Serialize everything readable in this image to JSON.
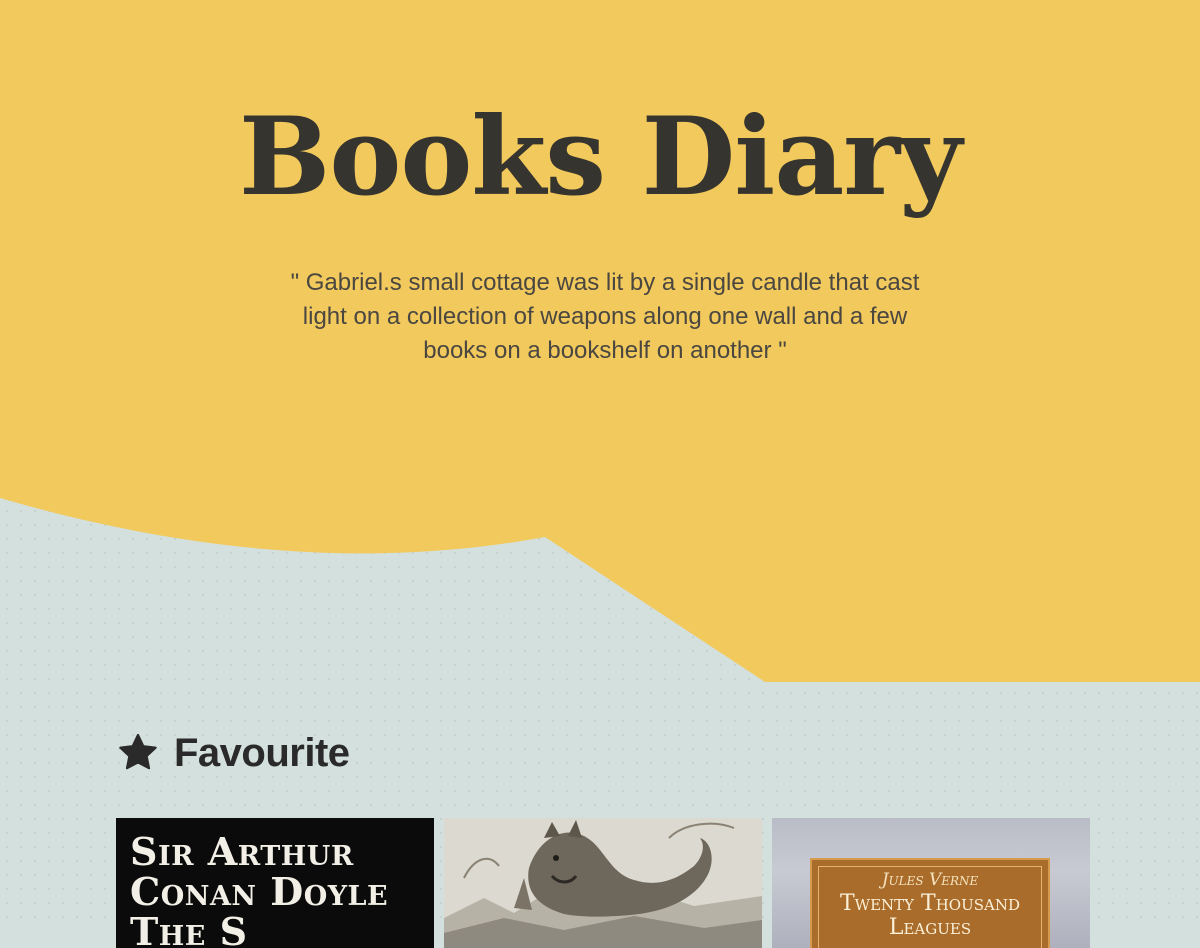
{
  "hero": {
    "title": "Books Diary",
    "quote": "\" Gabriel.s small cottage was lit by a single candle that cast light on a collection of weapons along one wall and a few books on a bookshelf on another \""
  },
  "favourites": {
    "icon": "star-icon",
    "heading": "Favourite",
    "books": [
      {
        "cover_text": "Sir Arthur\nConan Doyle\nThe S"
      },
      {
        "cover_text": ""
      },
      {
        "author": "Jules Verne",
        "title": "Twenty Thousand\nLeagues"
      }
    ]
  },
  "colors": {
    "hero_bg": "#f2c95d",
    "page_bg": "#d4e0dd",
    "title_color": "#36342f",
    "text_color": "#4a4741"
  }
}
